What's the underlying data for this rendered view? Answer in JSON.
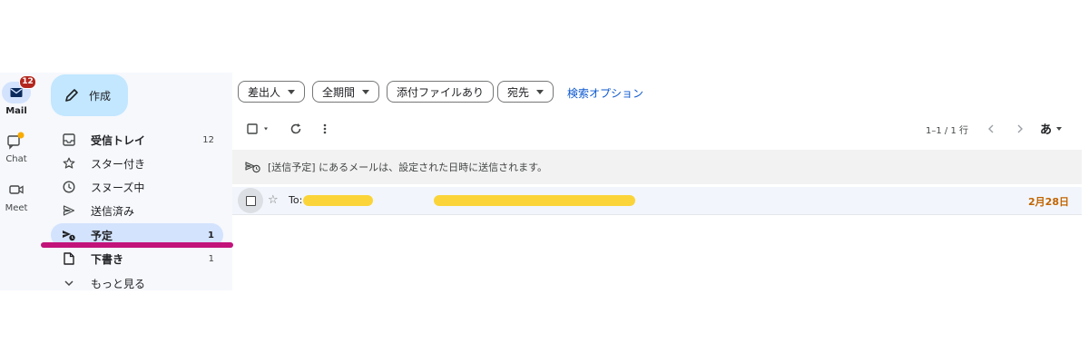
{
  "rail": {
    "mail": {
      "label": "Mail",
      "badge": "12",
      "icon": "mail-icon"
    },
    "chat": {
      "label": "Chat",
      "icon": "chat-icon"
    },
    "meet": {
      "label": "Meet",
      "icon": "video-icon"
    }
  },
  "sidebar": {
    "compose_label": "作成",
    "items": [
      {
        "label": "受信トレイ",
        "count": "12",
        "icon": "inbox-icon"
      },
      {
        "label": "スター付き",
        "count": "",
        "icon": "star-icon"
      },
      {
        "label": "スヌーズ中",
        "count": "",
        "icon": "clock-icon"
      },
      {
        "label": "送信済み",
        "count": "",
        "icon": "send-icon"
      },
      {
        "label": "予定",
        "count": "1",
        "icon": "scheduled-send-icon"
      },
      {
        "label": "下書き",
        "count": "1",
        "icon": "draft-icon"
      },
      {
        "label": "もっと見る",
        "count": "",
        "icon": "chevron-down-icon"
      }
    ]
  },
  "filters": {
    "chips": [
      "差出人",
      "全期間",
      "添付ファイルあり",
      "宛先"
    ],
    "search_options": "検索オプション"
  },
  "toolbar": {
    "pager": "1–1 / 1 行",
    "language": "あ"
  },
  "notice": {
    "text": "[送信予定] にあるメールは、設定された日時に送信されます。"
  },
  "messages": [
    {
      "to_prefix": "To:",
      "date": "2月28日"
    }
  ],
  "colors": {
    "accent": "#c2e7ff",
    "active_nav": "#d3e3fd",
    "badge": "#b3261e",
    "link": "#0b57d0",
    "date": "#c26401",
    "highlight": "#c2137a",
    "redaction": "#fbd43a"
  }
}
